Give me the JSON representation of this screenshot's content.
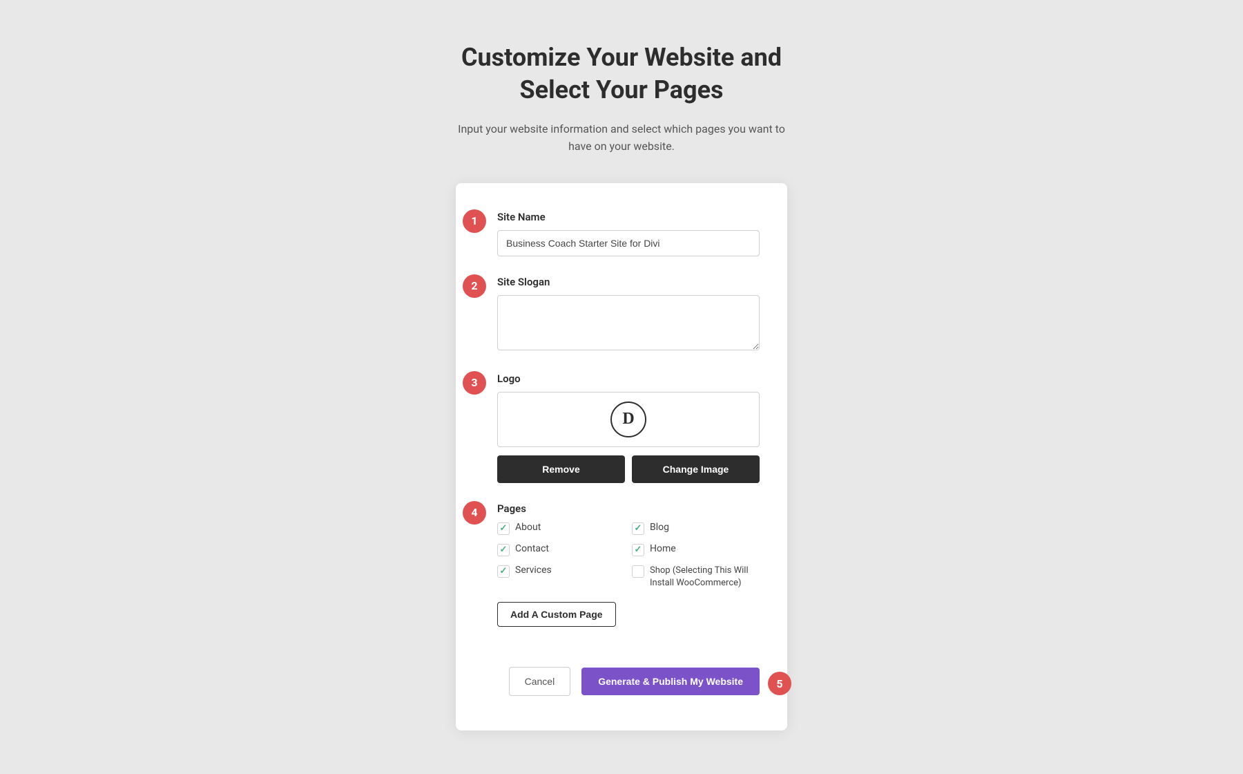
{
  "page": {
    "title_line1": "Customize Your Website and",
    "title_line2": "Select Your Pages",
    "subtitle": "Input your website information and select which pages you want to have on your website."
  },
  "steps": {
    "badge1": "1",
    "badge2": "2",
    "badge3": "3",
    "badge4": "4",
    "badge5": "5"
  },
  "form": {
    "site_name_label": "Site Name",
    "site_name_value": "Business Coach Starter Site for Divi",
    "site_name_placeholder": "Business Coach Starter Site for Divi",
    "site_slogan_label": "Site Slogan",
    "site_slogan_value": "",
    "site_slogan_placeholder": "",
    "logo_label": "Logo",
    "logo_symbol": "D",
    "remove_label": "Remove",
    "change_image_label": "Change Image",
    "pages_label": "Pages",
    "pages": [
      {
        "name": "About",
        "checked": true,
        "col": 1
      },
      {
        "name": "Blog",
        "checked": true,
        "col": 2
      },
      {
        "name": "Contact",
        "checked": true,
        "col": 1
      },
      {
        "name": "Home",
        "checked": true,
        "col": 2
      },
      {
        "name": "Services",
        "checked": true,
        "col": 1
      },
      {
        "name": "Shop (Selecting This Will Install WooCommerce)",
        "checked": false,
        "col": 2
      }
    ],
    "add_custom_page_label": "Add A Custom Page",
    "cancel_label": "Cancel",
    "publish_label": "Generate & Publish My Website"
  }
}
